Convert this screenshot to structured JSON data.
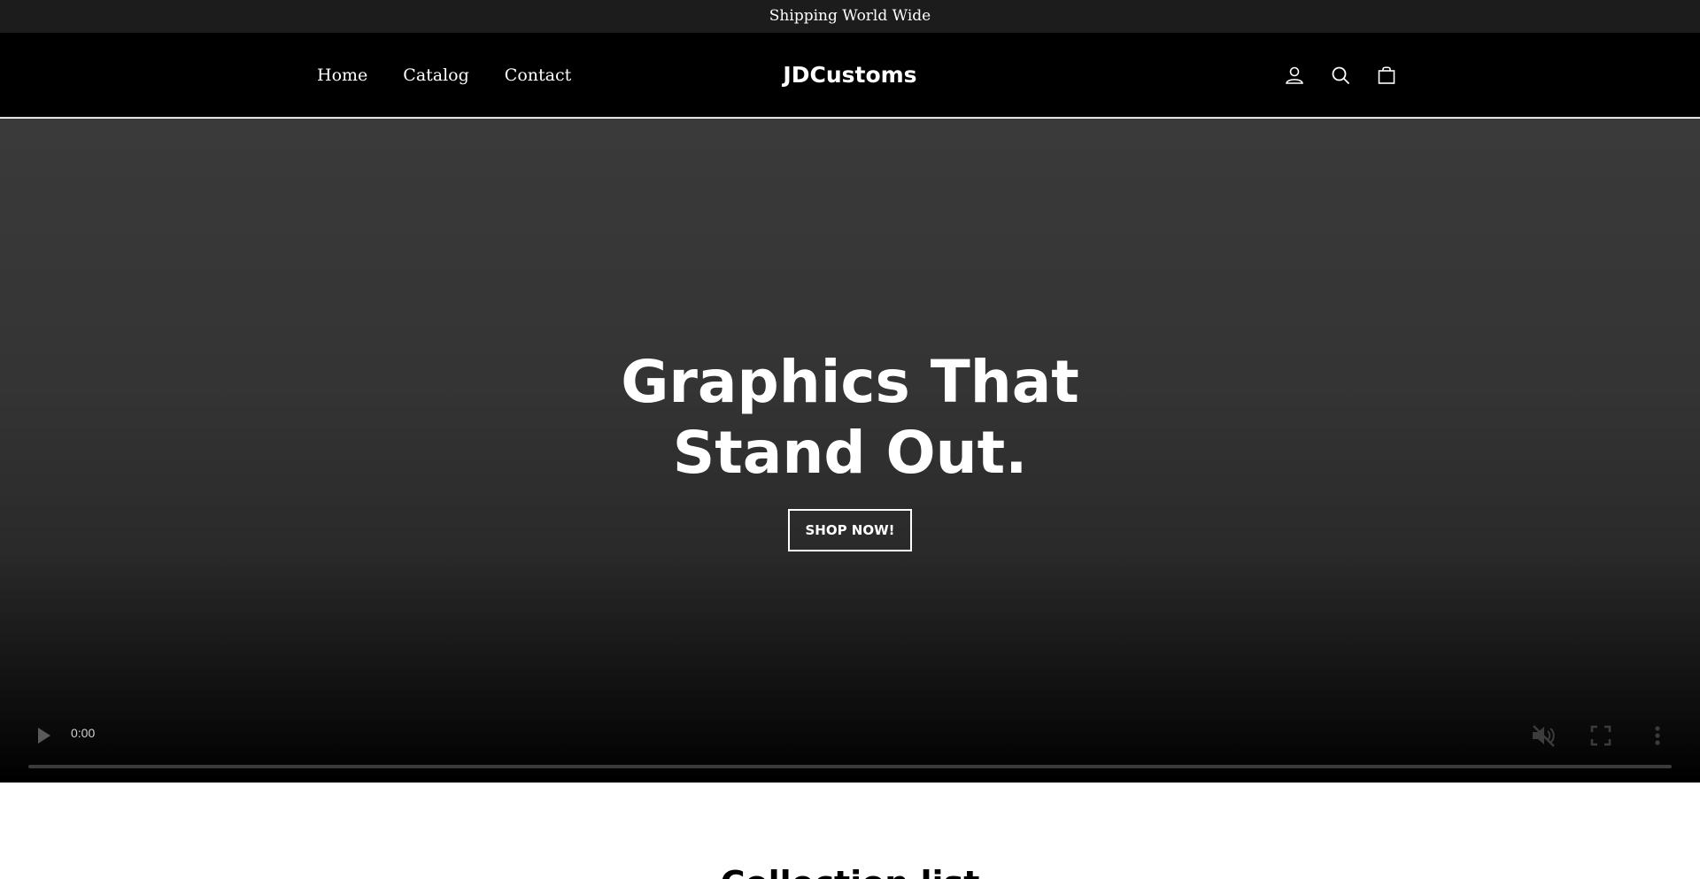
{
  "announcement": {
    "text": "Shipping World Wide"
  },
  "header": {
    "nav": [
      {
        "label": "Home"
      },
      {
        "label": "Catalog"
      },
      {
        "label": "Contact"
      }
    ],
    "logo": "JDCustoms",
    "icons": [
      "account-icon",
      "search-icon",
      "cart-icon"
    ]
  },
  "hero": {
    "heading_line1": "Graphics That",
    "heading_line2": "Stand Out.",
    "button_label": "SHOP NOW!",
    "video": {
      "time": "0:00",
      "progress": 0,
      "muted": true
    }
  },
  "collection": {
    "title": "Collection list"
  },
  "colors": {
    "announcement_bg": "#1c1c1c",
    "header_bg": "#000000",
    "text_light": "#ffffff"
  }
}
